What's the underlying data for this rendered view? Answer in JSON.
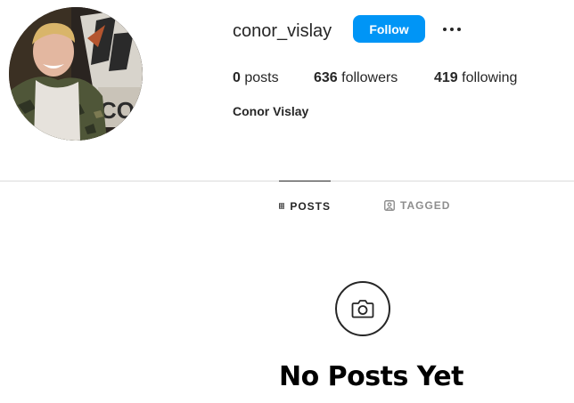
{
  "profile": {
    "username": "conor_vislay",
    "full_name": "Conor Vislay",
    "follow_label": "Follow",
    "more_icon": "more-horizontal-icon",
    "avatar": "profile-photo",
    "stats": {
      "posts_count": "0",
      "posts_label": "posts",
      "followers_count": "636",
      "followers_label": "followers",
      "following_count": "419",
      "following_label": "following"
    }
  },
  "tabs": [
    {
      "label": "POSTS",
      "icon": "grid-icon",
      "active": true
    },
    {
      "label": "TAGGED",
      "icon": "tagged-icon",
      "active": false
    }
  ],
  "empty_state": {
    "icon": "camera-icon",
    "title": "No Posts Yet"
  },
  "colors": {
    "accent": "#0095f6",
    "text": "#262626",
    "muted": "#8e8e8e",
    "divider": "#dbdbdb"
  }
}
